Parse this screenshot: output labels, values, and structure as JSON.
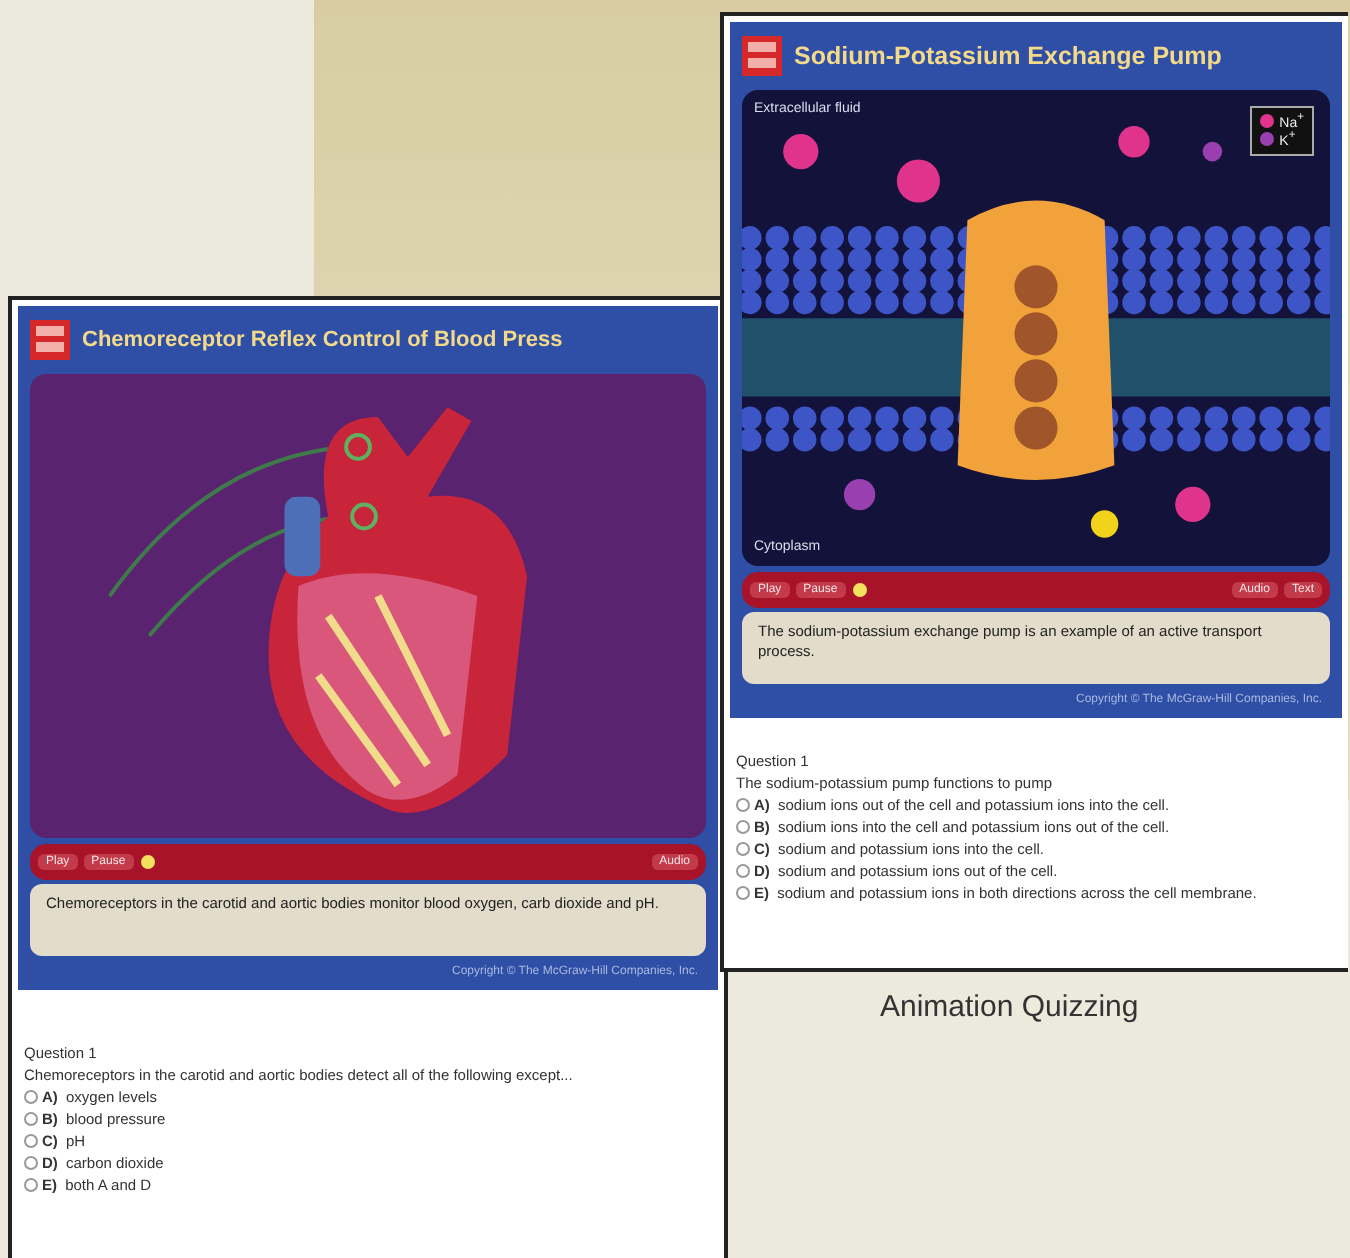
{
  "windows": [
    {
      "kind": "heart",
      "title": "Chemoreceptor Reflex Control of Blood Press",
      "controls_left": [
        "Play",
        "Pause"
      ],
      "controls_right": [
        "Audio"
      ],
      "caption": "Chemoreceptors in the carotid and aortic bodies monitor blood oxygen, carb dioxide and pH.",
      "copyright": "Copyright © The McGraw-Hill Companies, Inc.",
      "question": {
        "title": "Question 1",
        "prompt": "Chemoreceptors in the carotid and aortic bodies detect all of the following except...",
        "options": [
          {
            "letter": "A)",
            "text": "oxygen levels",
            "selected": false
          },
          {
            "letter": "B)",
            "text": "blood pressure",
            "selected": false
          },
          {
            "letter": "C)",
            "text": "pH",
            "selected": false
          },
          {
            "letter": "D)",
            "text": "carbon dioxide",
            "selected": false
          },
          {
            "letter": "E)",
            "text": "both A and D",
            "selected": false
          }
        ]
      }
    },
    {
      "kind": "pump",
      "title": "Sodium-Potassium Exchange Pump",
      "labels": [
        "Extracellular fluid",
        "Cytoplasm"
      ],
      "legend": [
        {
          "text": "Na$^{+}$",
          "color": "#e0338c"
        },
        {
          "text": "K$^{+}$",
          "color": "#9a3fb0"
        }
      ],
      "controls_left": [
        "Play",
        "Pause"
      ],
      "controls_right": [
        "Audio",
        "Text"
      ],
      "caption": "The sodium-potassium exchange pump is an example of an active transport process.",
      "copyright": "Copyright © The McGraw-Hill Companies, Inc.",
      "question": {
        "title": "Question 1",
        "prompt": "The sodium-potassium pump functions to pump",
        "options": [
          {
            "letter": "A)",
            "text": "sodium ions out of the cell and potassium ions into the cell.",
            "selected": false
          },
          {
            "letter": "B)",
            "text": "sodium ions into the cell and potassium ions out of the cell.",
            "selected": false
          },
          {
            "letter": "C)",
            "text": "sodium and potassium ions into the cell.",
            "selected": false
          },
          {
            "letter": "D)",
            "text": "sodium and potassium ions out of the cell.",
            "selected": false
          },
          {
            "letter": "E)",
            "text": "sodium and potassium ions in both directions across the cell membrane.",
            "selected": false
          }
        ]
      }
    }
  ],
  "feature_label": "Animation Quizzing"
}
